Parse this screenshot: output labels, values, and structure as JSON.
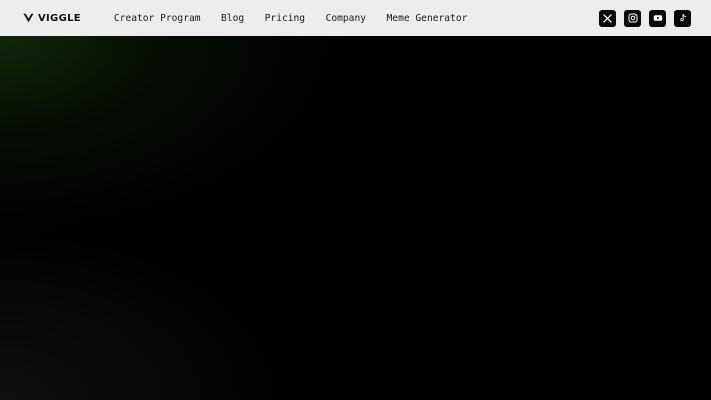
{
  "brand": {
    "name": "VIGGLE"
  },
  "nav": {
    "links": [
      {
        "label": "Creator Program"
      },
      {
        "label": "Blog"
      },
      {
        "label": "Pricing"
      },
      {
        "label": "Company"
      },
      {
        "label": "Meme Generator"
      }
    ]
  },
  "socials": [
    {
      "icon": "x-icon"
    },
    {
      "icon": "instagram-icon"
    },
    {
      "icon": "youtube-icon"
    },
    {
      "icon": "tiktok-icon"
    }
  ],
  "colors": {
    "navbar_bg": "#ededed",
    "hero_bg": "#000000",
    "accent_glow": "#142d0a"
  }
}
